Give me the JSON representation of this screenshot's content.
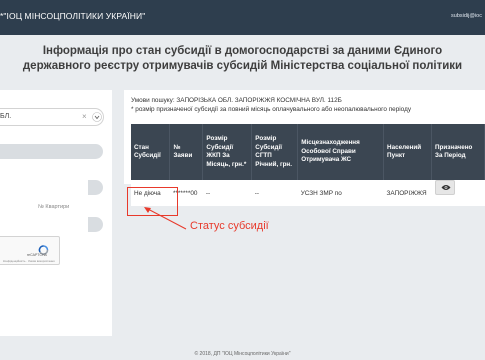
{
  "header": {
    "brand": "*\"ІОЦ МІНСОЦПОЛІТИКИ УКРАЇНИ\"",
    "user": "subsidij@ioc"
  },
  "page": {
    "title": "Інформація про стан субсидії в домогосподарстві за даними Єдиного державного реєстру отримувачів субсидій Міністерства соціальної політики"
  },
  "form": {
    "region_value": "БЛ.",
    "apartment_placeholder": "№ Квартири",
    "captcha_label": "reCAPTCHA",
    "captcha_links": "Конфіденційність · Умови використання"
  },
  "results": {
    "search_conditions": "Умови пошуку: ЗАПОРІЗЬКА ОБЛ. ЗАПОРІЖЖЯ КОСМІЧНА ВУЛ. 112Б",
    "note": "* розмір призначеної субсидії за повний місяць оплачувального або неопалювального періоду",
    "columns": [
      "Стан Субсидії",
      "№ Заяви",
      "Розмір Субсидії ЖКП За Місяць, грн.*",
      "Розмір Субсидії СГТП Річний, грн.",
      "Місцезнаходження Особової Справи Отримувача ЖС",
      "Населений Пункт",
      "Призначено За Період"
    ],
    "rows": [
      {
        "status": "Не діюча",
        "application_no": "*******00",
        "zhkp_amount": "--",
        "sgtp_amount": "--",
        "case_location": "УСЗН ЗМР по",
        "settlement": "ЗАПОРІЖЖЯ"
      }
    ]
  },
  "annotation": {
    "callout": "Статус субсидії",
    "color": "#e8392b"
  },
  "footer": {
    "text": "© 2018, ДП \"ІОЦ Мінсоцполітики України\""
  },
  "colors": {
    "topbar": "#2e3e4e",
    "table_header": "#3b4652",
    "page_bg": "#e9ecef"
  }
}
